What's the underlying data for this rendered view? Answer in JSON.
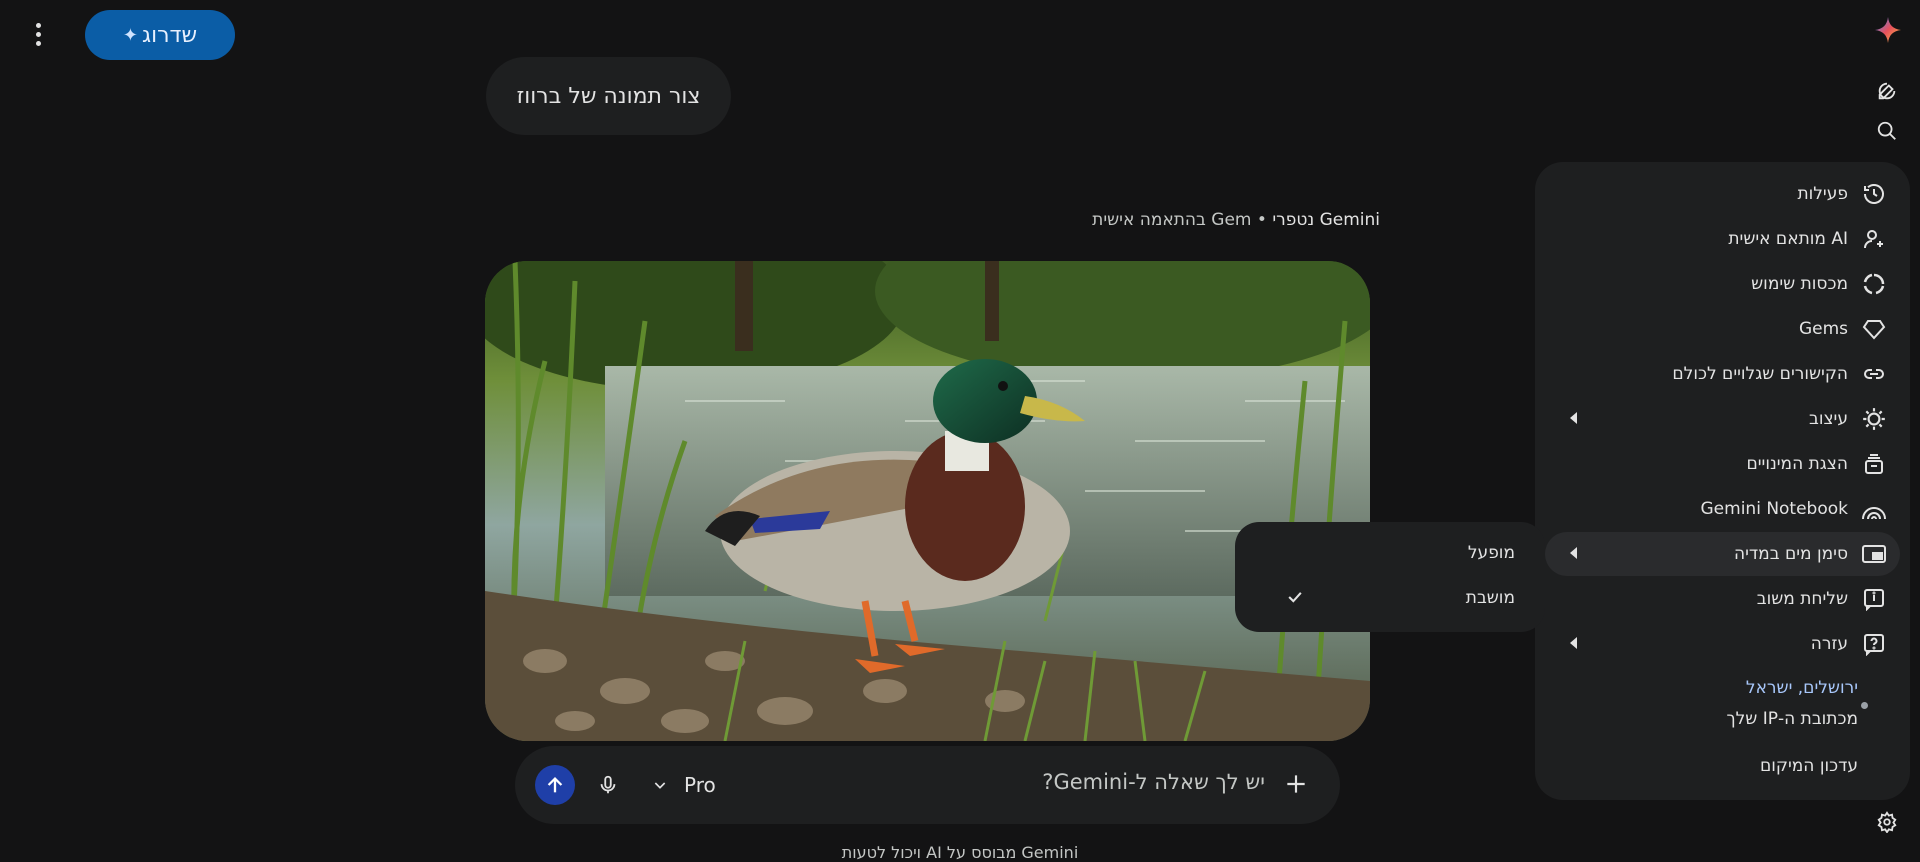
{
  "topbar": {
    "upgrade_label": "שדרוג",
    "upgrade_icon": "sparkle-icon",
    "menu_icon": "kebab-menu-icon",
    "logo_icon": "gemini-sparkle-logo"
  },
  "rail": {
    "new_chat_icon": "edit-icon",
    "search_icon": "search-icon",
    "settings_icon": "gear-icon"
  },
  "chat": {
    "user_prompt": "צור תמונה של ברווז",
    "model_name": "Gemini נטפרי",
    "model_separator": "•",
    "model_sub": "Gem בהתאמה אישית",
    "image_subject": "mallard duck by a pond"
  },
  "composer": {
    "placeholder": "יש לך שאלה ל-Gemini?",
    "model_label": "Pro",
    "send_icon": "arrow-up-icon",
    "mic_icon": "mic-icon",
    "add_icon": "plus-icon",
    "dropdown_icon": "chevron-down-icon"
  },
  "disclaimer": "Gemini מבוסס על AI ויכול לטעות",
  "settings_menu": {
    "items": [
      {
        "label": "פעילות",
        "icon": "history-icon",
        "has_submenu": false
      },
      {
        "label": "AI מותאם אישית",
        "icon": "person-sparkle-icon",
        "has_submenu": false
      },
      {
        "label": "מכסות שימוש",
        "icon": "usage-ring-icon",
        "has_submenu": false
      },
      {
        "label": "Gems",
        "icon": "gem-icon",
        "has_submenu": false
      },
      {
        "label": "הקישורים שגלויים לכולם",
        "icon": "link-icon",
        "has_submenu": false
      },
      {
        "label": "עיצוב",
        "icon": "theme-icon",
        "has_submenu": true
      },
      {
        "label": "הצגת המינויים",
        "icon": "subscriptions-icon",
        "has_submenu": false
      },
      {
        "label": "Gemini Notebook",
        "icon": "notebook-icon",
        "has_submenu": false
      },
      {
        "label": "סימן מים במדיה",
        "icon": "watermark-icon",
        "has_submenu": true
      },
      {
        "label": "שליחת משוב",
        "icon": "feedback-icon",
        "has_submenu": false
      },
      {
        "label": "עזרה",
        "icon": "help-icon",
        "has_submenu": true
      }
    ],
    "location": {
      "city": "ירושלים, ישראל",
      "source": "מכתובת ה-IP שלך",
      "update_label": "עדכון המיקום"
    }
  },
  "watermark_submenu": {
    "items": [
      {
        "label": "מופעל",
        "checked": false
      },
      {
        "label": "מושבת",
        "checked": true
      }
    ],
    "check_icon": "check-icon"
  },
  "colors": {
    "background": "#131314",
    "surface": "#1e1f20",
    "accent_blue": "#0b5da6",
    "send_blue": "#1f3fa8",
    "link_blue": "#a8c7fa"
  }
}
